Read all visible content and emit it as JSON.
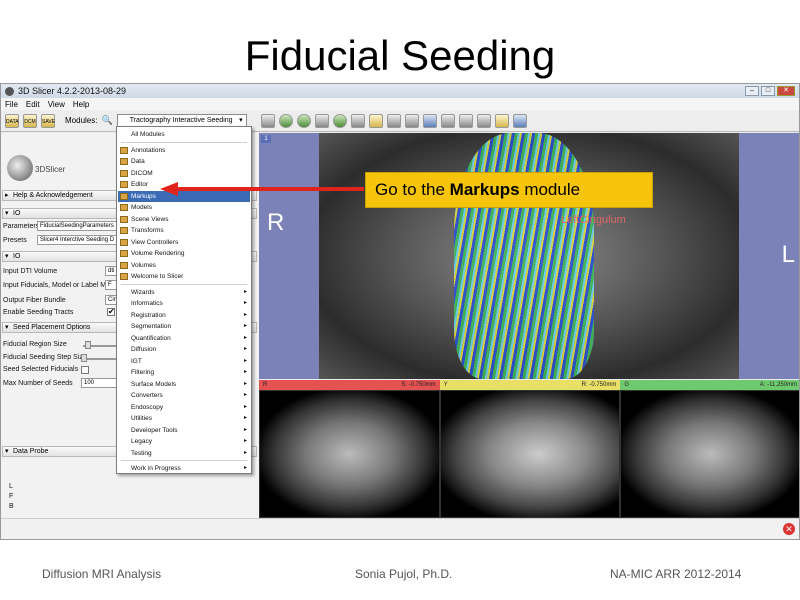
{
  "slide": {
    "title": "Fiducial Seeding",
    "footer_left": "Diffusion MRI Analysis",
    "footer_center": "Sonia Pujol, Ph.D.",
    "footer_right": "NA-MIC ARR 2012-2014"
  },
  "window": {
    "title": "3D Slicer 4.2.2-2013-08-29",
    "menu": [
      "File",
      "Edit",
      "View",
      "Help"
    ],
    "toolbar_icons": [
      "DATA",
      "DCM",
      "SAVE"
    ],
    "modules_label": "Modules:",
    "module_selected": "Tractography Interactive Seeding"
  },
  "left_panel": {
    "logo_text": "3DSlicer",
    "help_section": "Help & Acknowledgement",
    "io_section_1": "IO",
    "parameters_label": "Parameters",
    "parameters_value": "FiducialSeedingParameters",
    "presets_label": "Presets",
    "presets_value": "Slicer4 Interctive Seeding D",
    "io_section_2": "IO",
    "input_dti_label": "Input DTI Volume",
    "input_dti_value": "dti",
    "input_fid_label": "Input Fiducials, Model or Label Map",
    "input_fid_value": "F",
    "output_fiber_label": "Output Fiber Bundle",
    "output_fiber_value": "Cin",
    "enable_seeding_label": "Enable Seeding Tracts",
    "enable_seeding_check": "✔",
    "seed_section": "Seed Placement Options",
    "fid_region_label": "Fiducial Region Size",
    "fid_step_label": "Fiducial Seeding Step Size",
    "seed_selected_label": "Seed Selected Fiducials",
    "max_seeds_label": "Max Number of Seeds",
    "max_seeds_value": "100",
    "data_probe": "Data Probe",
    "probe_L": "L",
    "probe_F": "F",
    "probe_B": "B"
  },
  "dropdown": {
    "items_top": [
      "All Modules"
    ],
    "items_main": [
      "Annotations",
      "Data",
      "DICOM",
      "Editor",
      "Markups",
      "Models",
      "Scene Views",
      "Transforms",
      "View Controllers",
      "Volume Rendering",
      "Volumes",
      "Welcome to Slicer"
    ],
    "highlighted": "Markups",
    "items_categories": [
      "Wizards",
      "Informatics",
      "Registration",
      "Segmentation",
      "Quantification",
      "Diffusion",
      "IGT",
      "Filtering",
      "Surface Models",
      "Converters",
      "Endoscopy",
      "Utilities",
      "Developer Tools",
      "Legacy",
      "Testing"
    ],
    "items_bottom": [
      "Work in Progress"
    ]
  },
  "view3d": {
    "label_R": "R",
    "label_L": "L",
    "cingulum_label": "LeftCingulum",
    "view_tag": "1"
  },
  "slice_bars": {
    "red_label": "R",
    "red_value": "S: -0.750mm",
    "yellow_label": "Y",
    "yellow_value": "R: -0.750mm",
    "green_label": "G",
    "green_value": "A: -11.250mm"
  },
  "callout": {
    "prefix": "Go to the ",
    "bold": "Markups",
    "suffix": " module"
  },
  "colors": {
    "callout_bg": "#f5c40b",
    "arrow": "#e0231b",
    "highlight": "#3b6bb5"
  }
}
